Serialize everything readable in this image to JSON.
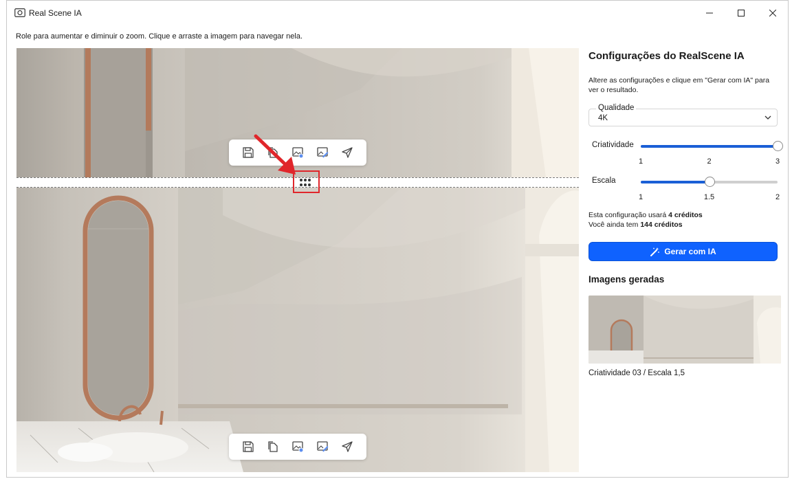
{
  "window": {
    "title": "Real Scene IA",
    "icons": {
      "app": "camera-icon",
      "minimize": "minimize-icon",
      "maximize": "maximize-icon",
      "close": "close-icon"
    }
  },
  "viewer": {
    "instruction": "Role para aumentar e diminuir o zoom. Clique e arraste a imagem para navegar nela.",
    "toolbar_icons": [
      "save-icon",
      "copy-icon",
      "image-settings-icon",
      "edit-image-icon",
      "send-icon"
    ],
    "colors": {
      "highlight": "#e0262b",
      "arrow": "#e0262b"
    }
  },
  "panel": {
    "title": "Configurações do RealScene IA",
    "description": "Altere as configurações e clique em \"Gerar com IA\" para ver o resultado.",
    "quality": {
      "label": "Qualidade",
      "value": "4K"
    },
    "creativity": {
      "label": "Criatividade",
      "ticks": [
        "1",
        "2",
        "3"
      ],
      "min": 1,
      "max": 3,
      "value": 3
    },
    "scale": {
      "label": "Escala",
      "ticks": [
        "1",
        "1.5",
        "2"
      ],
      "min": 1,
      "max": 2,
      "value": 1.5
    },
    "credits": {
      "line1_prefix": "Esta configuração usará ",
      "line1_bold": "4 créditos",
      "line2_prefix": "Você ainda tem ",
      "line2_bold": "144 créditos"
    },
    "generate_button": "Gerar com IA",
    "generated_title": "Imagens geradas",
    "generated_items": [
      {
        "caption": "Criatividade 03 / Escala 1,5"
      }
    ],
    "colors": {
      "accent": "#0f62fe",
      "slider": "#1a5fd6"
    }
  }
}
